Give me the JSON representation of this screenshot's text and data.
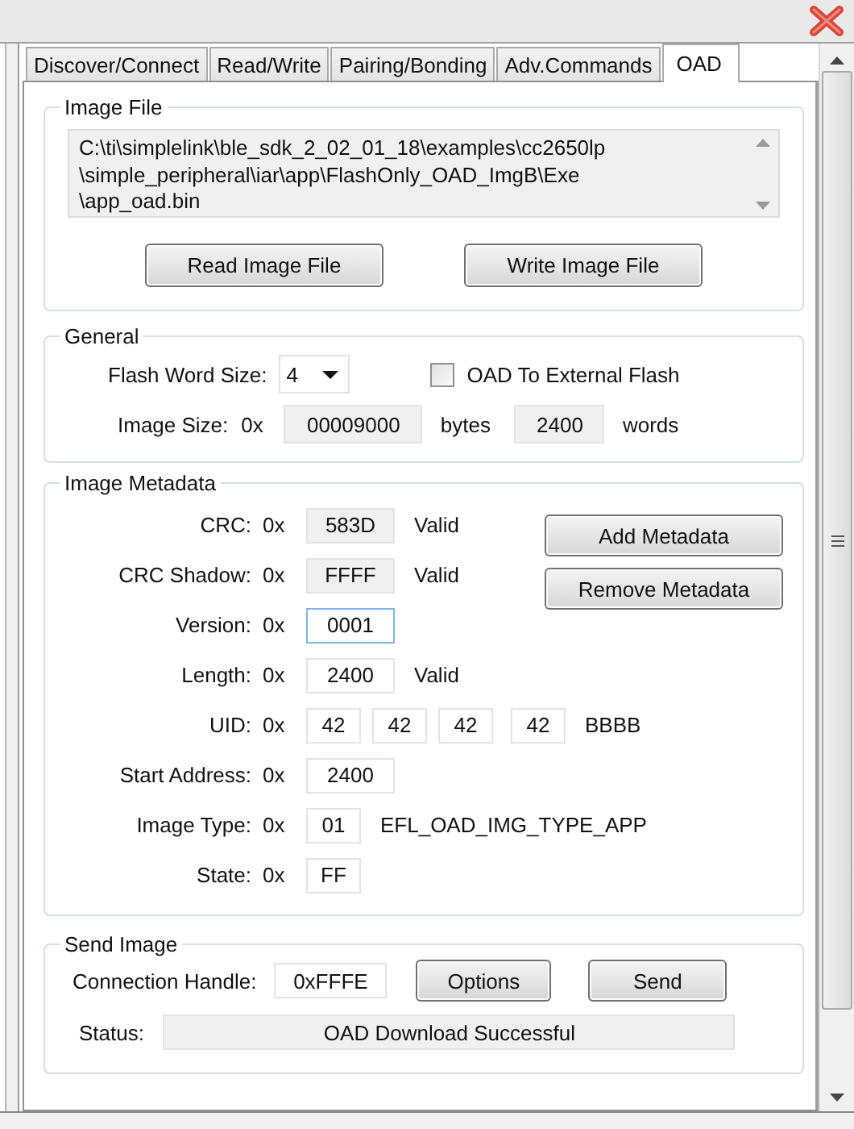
{
  "tabs": [
    {
      "label": "Discover/Connect",
      "selected": false
    },
    {
      "label": "Read/Write",
      "selected": false
    },
    {
      "label": "Pairing/Bonding",
      "selected": false
    },
    {
      "label": "Adv.Commands",
      "selected": false
    },
    {
      "label": "OAD",
      "selected": true
    }
  ],
  "image_file": {
    "title": "Image File",
    "path_lines": [
      "C:\\ti\\simplelink\\ble_sdk_2_02_01_18\\examples\\cc2650lp",
      "\\simple_peripheral\\iar\\app\\FlashOnly_OAD_ImgB\\Exe",
      "\\app_oad.bin"
    ],
    "buttons": [
      "Read Image File",
      "Write Image File"
    ]
  },
  "general": {
    "title": "General",
    "flash_word_size": {
      "label": "Flash Word Size:",
      "value": "4"
    },
    "external_flash": {
      "label": "OAD To External Flash",
      "checked": false
    },
    "image_size": {
      "label": "Image Size:",
      "prefix": "0x",
      "value": "00009000",
      "unit": "bytes",
      "words_value": "2400",
      "words_unit": "words"
    }
  },
  "metadata": {
    "title": "Image Metadata",
    "rows": [
      {
        "label": "CRC:",
        "prefix": "0x",
        "fields": [
          {
            "value": "583D",
            "readonly": true,
            "focused": false
          }
        ],
        "note": "Valid"
      },
      {
        "label": "CRC Shadow:",
        "prefix": "0x",
        "fields": [
          {
            "value": "FFFF",
            "readonly": true,
            "focused": false
          }
        ],
        "note": "Valid"
      },
      {
        "label": "Version:",
        "prefix": "0x",
        "fields": [
          {
            "value": "0001",
            "readonly": false,
            "focused": true
          }
        ]
      },
      {
        "label": "Length:",
        "prefix": "0x",
        "fields": [
          {
            "value": "2400",
            "readonly": false,
            "focused": false
          }
        ],
        "note": "Valid"
      },
      {
        "label": "UID:",
        "prefix": "0x",
        "fields": [
          {
            "value": "42",
            "readonly": false,
            "focused": false
          },
          {
            "value": "42",
            "readonly": false,
            "focused": false
          },
          {
            "value": "42",
            "readonly": false,
            "focused": false
          },
          {
            "value": "42",
            "readonly": false,
            "focused": false
          }
        ],
        "note": "BBBB"
      },
      {
        "label": "Start Address:",
        "prefix": "0x",
        "fields": [
          {
            "value": "2400",
            "readonly": false,
            "focused": false
          }
        ]
      },
      {
        "label": "Image Type:",
        "prefix": "0x",
        "fields": [
          {
            "value": "01",
            "readonly": false,
            "focused": false
          }
        ],
        "note": "EFL_OAD_IMG_TYPE_APP"
      },
      {
        "label": "State:",
        "prefix": "0x",
        "fields": [
          {
            "value": "FF",
            "readonly": false,
            "focused": false
          }
        ]
      }
    ],
    "buttons": [
      "Add Metadata",
      "Remove Metadata"
    ]
  },
  "send_image": {
    "title": "Send Image",
    "handle_label": "Connection Handle:",
    "handle_value": "0xFFFE",
    "buttons": [
      "Options",
      "Send"
    ],
    "status_label": "Status:",
    "status_value": "OAD Download Successful"
  }
}
